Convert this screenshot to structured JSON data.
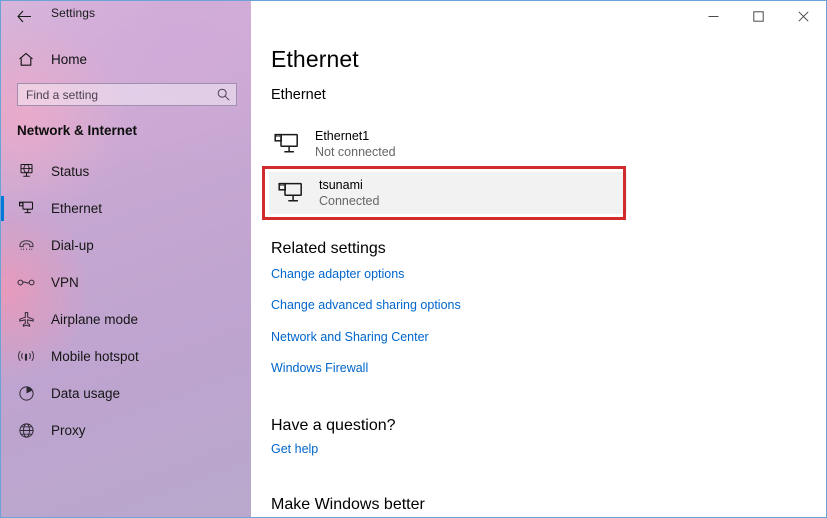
{
  "window": {
    "app_title": "Settings",
    "back_icon": "back-arrow-icon",
    "controls": {
      "minimize": "minimize-icon",
      "maximize": "maximize-icon",
      "close": "close-icon"
    }
  },
  "sidebar": {
    "home": {
      "label": "Home",
      "icon": "home-icon"
    },
    "search": {
      "placeholder": "Find a setting",
      "value": "",
      "icon": "search-icon"
    },
    "section_title": "Network & Internet",
    "items": [
      {
        "label": "Status",
        "icon": "status-globe-monitor-icon",
        "selected": false
      },
      {
        "label": "Ethernet",
        "icon": "ethernet-monitor-icon",
        "selected": true
      },
      {
        "label": "Dial-up",
        "icon": "dialup-phone-icon",
        "selected": false
      },
      {
        "label": "VPN",
        "icon": "vpn-key-icon",
        "selected": false
      },
      {
        "label": "Airplane mode",
        "icon": "airplane-icon",
        "selected": false
      },
      {
        "label": "Mobile hotspot",
        "icon": "hotspot-signal-icon",
        "selected": false
      },
      {
        "label": "Data usage",
        "icon": "pie-chart-icon",
        "selected": false
      },
      {
        "label": "Proxy",
        "icon": "globe-icon",
        "selected": false
      }
    ]
  },
  "main": {
    "page_title": "Ethernet",
    "sub_heading": "Ethernet",
    "connections": [
      {
        "name": "Ethernet1",
        "status": "Not connected",
        "icon": "ethernet-adapter-icon",
        "highlighted": false
      },
      {
        "name": "tsunami",
        "status": "Connected",
        "icon": "ethernet-adapter-icon",
        "highlighted": true
      }
    ],
    "related": {
      "title": "Related settings",
      "links": [
        "Change adapter options",
        "Change advanced sharing options",
        "Network and Sharing Center",
        "Windows Firewall"
      ]
    },
    "question": {
      "title": "Have a question?",
      "link": "Get help"
    },
    "feedback": {
      "title": "Make Windows better"
    }
  },
  "colors": {
    "accent": "#0078d7",
    "link": "#0066cc",
    "annotation": "#d22b2b",
    "selected_row_bg": "#f2f2f2",
    "window_border": "#6ba3d6"
  }
}
